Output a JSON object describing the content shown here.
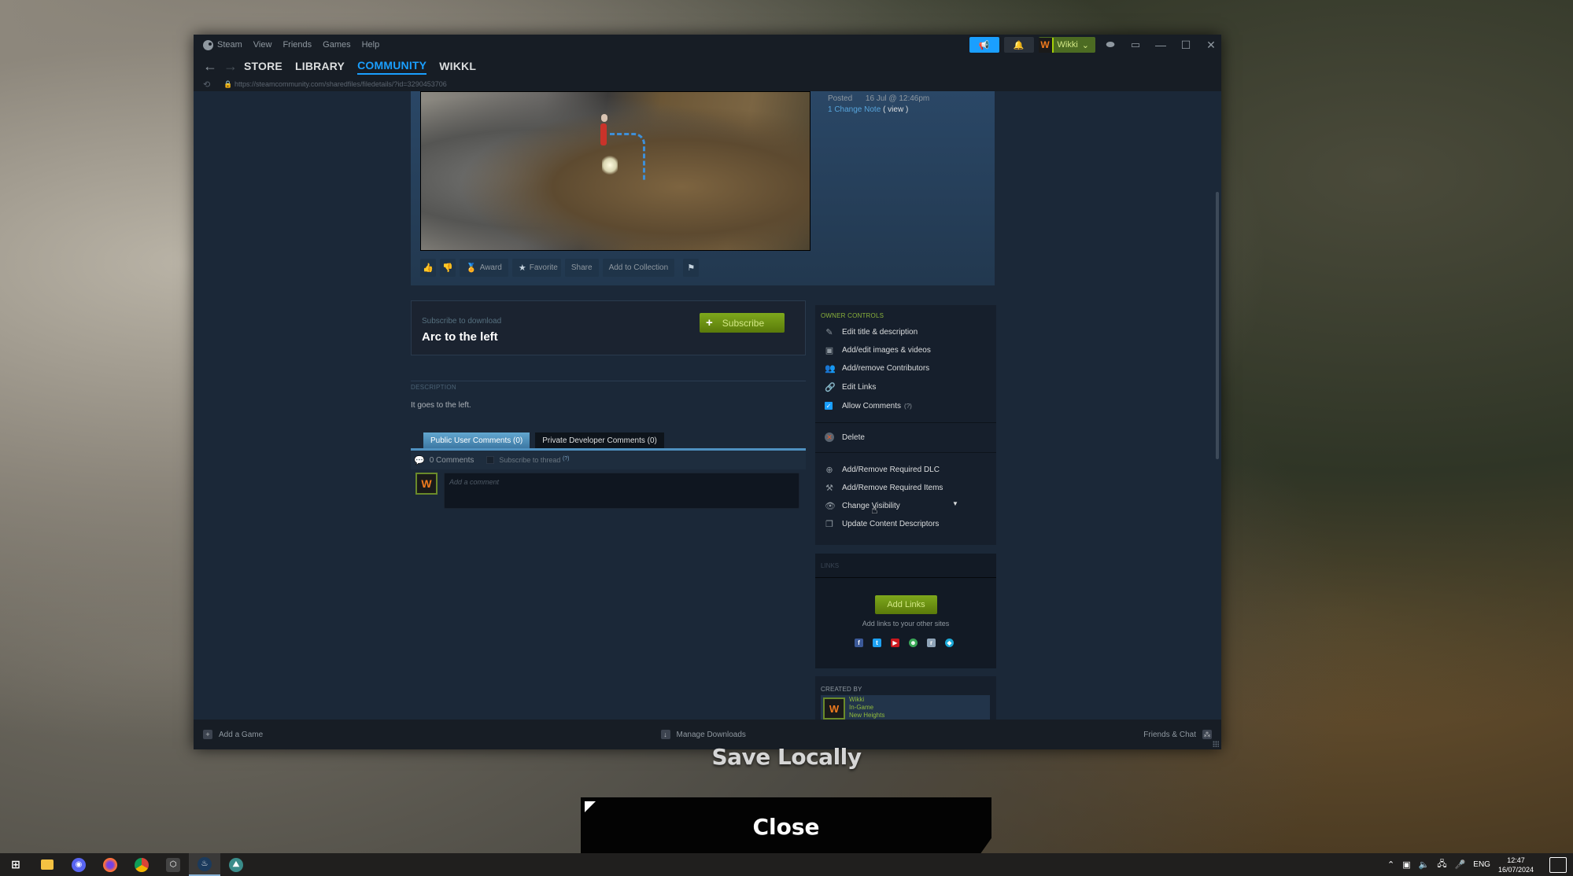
{
  "window": {
    "menu": [
      "Steam",
      "View",
      "Friends",
      "Games",
      "Help"
    ],
    "titlebar": {
      "user_name": "Wikki",
      "avatar_letter": "W"
    },
    "nav_tabs": [
      {
        "label": "STORE",
        "active": false
      },
      {
        "label": "LIBRARY",
        "active": false
      },
      {
        "label": "COMMUNITY",
        "active": true
      },
      {
        "label": "WIKKL",
        "active": false
      }
    ],
    "url": "https://steamcommunity.com/sharedfiles/filedetails/?id=3290453706"
  },
  "item": {
    "posted_label": "Posted",
    "posted_value": "16 Jul @ 12:46pm",
    "change_note": "1 Change Note",
    "change_note_view": "( view )",
    "actions": {
      "award": "Award",
      "favorite": "Favorite",
      "share": "Share",
      "add_to_collection": "Add to Collection"
    },
    "subscribe_label": "Subscribe to download",
    "title": "Arc to the left",
    "subscribe_button": "Subscribe",
    "description_label": "DESCRIPTION",
    "description": "It goes to the left."
  },
  "comments": {
    "tabs": [
      {
        "label": "Public User Comments (0)",
        "active": true
      },
      {
        "label": "Private Developer Comments (0)",
        "active": false
      }
    ],
    "count_label": "0 Comments",
    "subscribe_thread": "Subscribe to thread",
    "help_mark": "(?)",
    "placeholder": "Add a comment",
    "avatar_letter": "W"
  },
  "owner_controls": {
    "title": "OWNER CONTROLS",
    "items": [
      {
        "label": "Edit title & description",
        "icon": "edit-icon"
      },
      {
        "label": "Add/edit images & videos",
        "icon": "image-icon"
      },
      {
        "label": "Add/remove Contributors",
        "icon": "contributors-icon"
      },
      {
        "label": "Edit Links",
        "icon": "link-icon"
      }
    ],
    "allow_comments": {
      "label": "Allow Comments",
      "checked": true,
      "help": "(?)"
    },
    "delete": "Delete",
    "items2": [
      {
        "label": "Add/Remove Required DLC",
        "icon": "dlc-icon"
      },
      {
        "label": "Add/Remove Required Items",
        "icon": "items-icon"
      },
      {
        "label": "Change Visibility",
        "icon": "eye-icon"
      },
      {
        "label": "Update Content Descriptors",
        "icon": "descriptors-icon"
      }
    ]
  },
  "links": {
    "title": "LINKS",
    "button": "Add Links",
    "subtitle": "Add links to your other sites",
    "social": [
      {
        "name": "facebook",
        "glyph": "f",
        "color": "#3b5998"
      },
      {
        "name": "twitter",
        "glyph": "t",
        "color": "#1da1f2"
      },
      {
        "name": "youtube",
        "glyph": "▶",
        "color": "#cc181e"
      },
      {
        "name": "discord-smile",
        "glyph": "☻",
        "color": "#3aa757"
      },
      {
        "name": "reddit",
        "glyph": "r",
        "color": "#8fa4b8"
      },
      {
        "name": "sketchfab",
        "glyph": "◆",
        "color": "#1caad9"
      }
    ]
  },
  "created_by": {
    "title": "CREATED BY",
    "name": "Wikki",
    "status": "In-Game",
    "game": "New Heights",
    "avatar_letter": "W"
  },
  "bottom_bar": {
    "add_game": "Add a Game",
    "manage_downloads": "Manage Downloads",
    "friends_chat": "Friends & Chat"
  },
  "overlay": {
    "save_locally": "Save Locally",
    "close": "Close"
  },
  "taskbar": {
    "apps": [
      "windows-start",
      "file-explorer",
      "discord",
      "firefox",
      "chrome",
      "unity-hub",
      "steam",
      "new-heights"
    ],
    "language": "ENG",
    "time": "12:47",
    "date": "16/07/2024"
  },
  "colors": {
    "steam_blue": "#1a9fff",
    "steam_green": "#a4d007",
    "window_bg": "#1b2838"
  }
}
